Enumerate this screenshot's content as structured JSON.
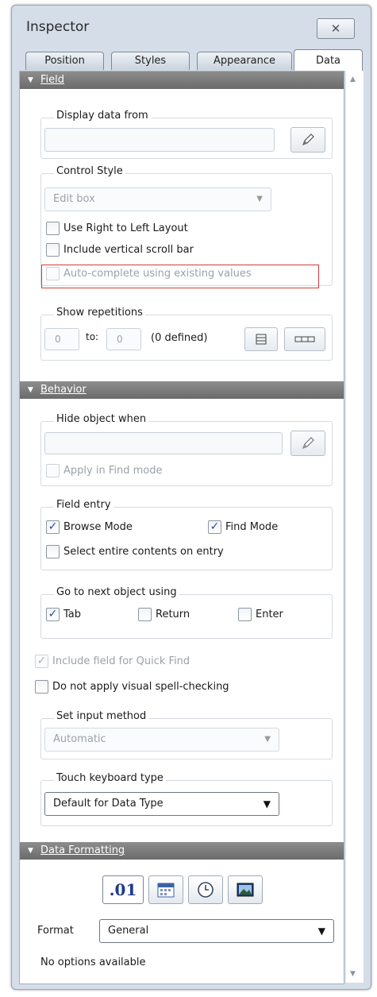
{
  "window": {
    "title": "Inspector",
    "close_icon": "close-icon"
  },
  "tabs": [
    "Position",
    "Styles",
    "Appearance",
    "Data"
  ],
  "active_tab": "Data",
  "sections": {
    "field": "Field",
    "behavior": "Behavior",
    "data_formatting": "Data Formatting"
  },
  "field": {
    "display_data_from": {
      "label": "Display data from",
      "value": ""
    },
    "control_style": {
      "label": "Control Style",
      "value": "Edit box",
      "use_rtl": {
        "label": "Use Right to Left Layout",
        "checked": false
      },
      "vertical_scroll": {
        "label": "Include vertical scroll bar",
        "checked": false
      },
      "autocomplete": {
        "label": "Auto-complete using existing values",
        "checked": false,
        "enabled": false
      }
    },
    "show_repetitions": {
      "label": "Show repetitions",
      "from": "0",
      "to_label": "to:",
      "to": "0",
      "defined": "(0 defined)"
    }
  },
  "behavior": {
    "hide_object_when": {
      "label": "Hide object when",
      "value": "",
      "apply_find": {
        "label": "Apply in Find mode",
        "checked": false,
        "enabled": false
      }
    },
    "field_entry": {
      "label": "Field entry",
      "browse": {
        "label": "Browse Mode",
        "checked": true
      },
      "find": {
        "label": "Find Mode",
        "checked": true
      },
      "select_entire": {
        "label": "Select entire contents on entry",
        "checked": false
      }
    },
    "go_to_next": {
      "label": "Go to next object using",
      "tab": {
        "label": "Tab",
        "checked": true
      },
      "return": {
        "label": "Return",
        "checked": false
      },
      "enter": {
        "label": "Enter",
        "checked": false
      }
    },
    "quick_find": {
      "label": "Include field for Quick Find",
      "checked": true,
      "enabled": false
    },
    "spell_check": {
      "label": "Do not apply visual spell-checking",
      "checked": false
    },
    "input_method": {
      "label": "Set input method",
      "value": "Automatic"
    },
    "touch_keyboard": {
      "label": "Touch keyboard type",
      "value": "Default for Data Type"
    }
  },
  "data_formatting": {
    "decimal_label": ".01",
    "icons": [
      "calendar-icon",
      "clock-icon",
      "image-icon"
    ],
    "format_label": "Format",
    "format_value": "General",
    "no_options": "No options available"
  },
  "colors": {
    "section_header": "#7a7a7a",
    "highlight_box": "#d23c3c",
    "check": "#2b47a8",
    "window_bg": "#d4dde8"
  }
}
